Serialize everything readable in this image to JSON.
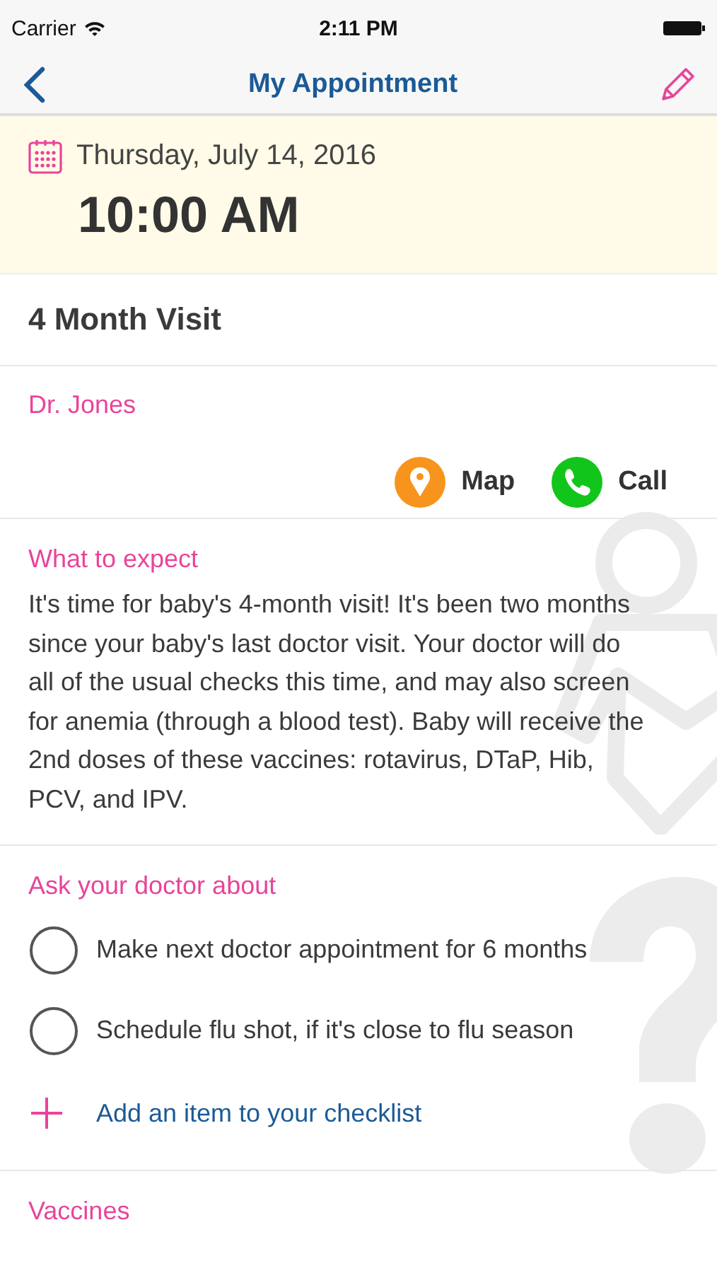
{
  "status_bar": {
    "carrier": "Carrier",
    "time": "2:11 PM"
  },
  "nav": {
    "title": "My Appointment"
  },
  "appointment": {
    "date": "Thursday, July 14, 2016",
    "time": "10:00 AM",
    "title": "4 Month Visit",
    "doctor": "Dr. Jones"
  },
  "actions": [
    {
      "kind": "map",
      "label": "Map"
    },
    {
      "kind": "call",
      "label": "Call"
    }
  ],
  "what_to_expect": {
    "heading": "What to expect",
    "text": "It's time for baby's 4-month visit! It's been two months since your baby's last doctor visit. Your doctor will do all of the usual checks this time, and may also screen for anemia (through a blood test). Baby will receive the 2nd doses of these vaccines: rotavirus, DTaP, Hib, PCV, and IPV."
  },
  "ask_doctor": {
    "heading": "Ask your doctor about",
    "items": [
      {
        "text": "Make next doctor appointment for 6 months",
        "checked": false
      },
      {
        "text": "Schedule flu shot, if it's close to flu season",
        "checked": false
      }
    ],
    "add_label": "Add an item to your checklist"
  },
  "vaccines": {
    "heading": "Vaccines"
  }
}
